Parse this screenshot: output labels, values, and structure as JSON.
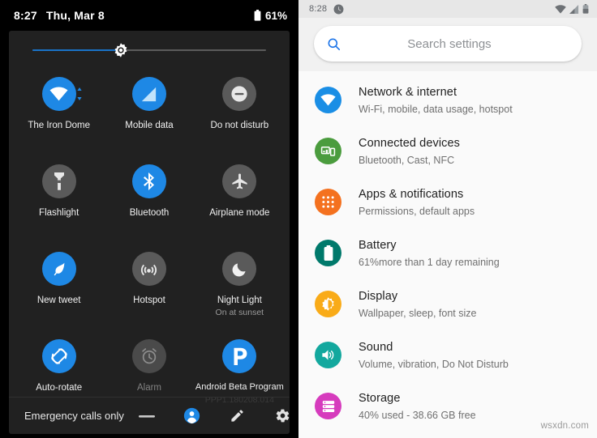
{
  "quick_settings": {
    "status_bar": {
      "time": "8:27",
      "date": "Thu, Mar 8",
      "battery_percent": "61%",
      "battery_icon": "battery-icon"
    },
    "brightness": {
      "icon": "brightness-icon",
      "value_percent": 38,
      "fill_color": "#1a73c8",
      "track_color": "#5b5b5b"
    },
    "tiles": [
      {
        "label": "The Iron Dome",
        "sub": "",
        "icon": "wifi-icon",
        "state": "on",
        "badge": "data-activity-icon"
      },
      {
        "label": "Mobile data",
        "sub": "",
        "icon": "mobile-data-icon",
        "state": "on",
        "badge": ""
      },
      {
        "label": "Do not disturb",
        "sub": "",
        "icon": "do-not-disturb-icon",
        "state": "off",
        "badge": ""
      },
      {
        "label": "Flashlight",
        "sub": "",
        "icon": "flashlight-icon",
        "state": "off",
        "badge": ""
      },
      {
        "label": "Bluetooth",
        "sub": "",
        "icon": "bluetooth-icon",
        "state": "on",
        "badge": ""
      },
      {
        "label": "Airplane mode",
        "sub": "",
        "icon": "airplane-icon",
        "state": "off",
        "badge": ""
      },
      {
        "label": "New tweet",
        "sub": "",
        "icon": "twitter-feather-icon",
        "state": "on",
        "badge": ""
      },
      {
        "label": "Hotspot",
        "sub": "",
        "icon": "hotspot-icon",
        "state": "off",
        "badge": ""
      },
      {
        "label": "Night Light",
        "sub": "On at sunset",
        "icon": "moon-icon",
        "state": "off",
        "badge": ""
      },
      {
        "label": "Auto-rotate",
        "sub": "",
        "icon": "auto-rotate-icon",
        "state": "on",
        "badge": ""
      },
      {
        "label": "Alarm",
        "sub": "",
        "icon": "alarm-icon",
        "state": "dim",
        "badge": ""
      },
      {
        "label": "Android Beta Program",
        "sub": "PPP1.180208.014",
        "icon": "beta-p-icon",
        "state": "on",
        "badge": ""
      }
    ],
    "footer": {
      "carrier": "Emergency calls only",
      "actions": [
        {
          "name": "power-menu-icon",
          "label": "power"
        },
        {
          "name": "user-avatar-icon",
          "label": "user"
        },
        {
          "name": "edit-pencil-icon",
          "label": "edit"
        },
        {
          "name": "settings-gear-icon",
          "label": "settings"
        }
      ]
    },
    "colors": {
      "tile_on": "#1e88e5",
      "tile_off": "#5a5a5a",
      "panel_bg": "#212121",
      "screen_bg": "#000000"
    }
  },
  "settings": {
    "status_bar": {
      "time": "8:28",
      "left_icon": "alarm-clock-icon",
      "right_icons": [
        "wifi-icon",
        "signal-icon",
        "battery-icon"
      ]
    },
    "search": {
      "placeholder": "Search settings",
      "icon": "search-icon"
    },
    "items": [
      {
        "title": "Network & internet",
        "subtitle": "Wi-Fi, mobile, data usage, hotspot",
        "icon": "wifi-icon",
        "color": "#1a8ee5"
      },
      {
        "title": "Connected devices",
        "subtitle": "Bluetooth, Cast, NFC",
        "icon": "connected-devices-icon",
        "color": "#4b9c3e"
      },
      {
        "title": "Apps & notifications",
        "subtitle": "Permissions, default apps",
        "icon": "apps-grid-icon",
        "color": "#f4711f"
      },
      {
        "title": "Battery",
        "subtitle": "61%more than 1 day remaining",
        "icon": "battery-icon",
        "color": "#00796b"
      },
      {
        "title": "Display",
        "subtitle": "Wallpaper, sleep, font size",
        "icon": "brightness-icon",
        "color": "#f9ab18"
      },
      {
        "title": "Sound",
        "subtitle": "Volume, vibration, Do Not Disturb",
        "icon": "volume-icon",
        "color": "#13a89e"
      },
      {
        "title": "Storage",
        "subtitle": "40% used - 38.66 GB free",
        "icon": "storage-icon",
        "color": "#d63bbd"
      }
    ]
  },
  "watermark": "wsxdn.com"
}
